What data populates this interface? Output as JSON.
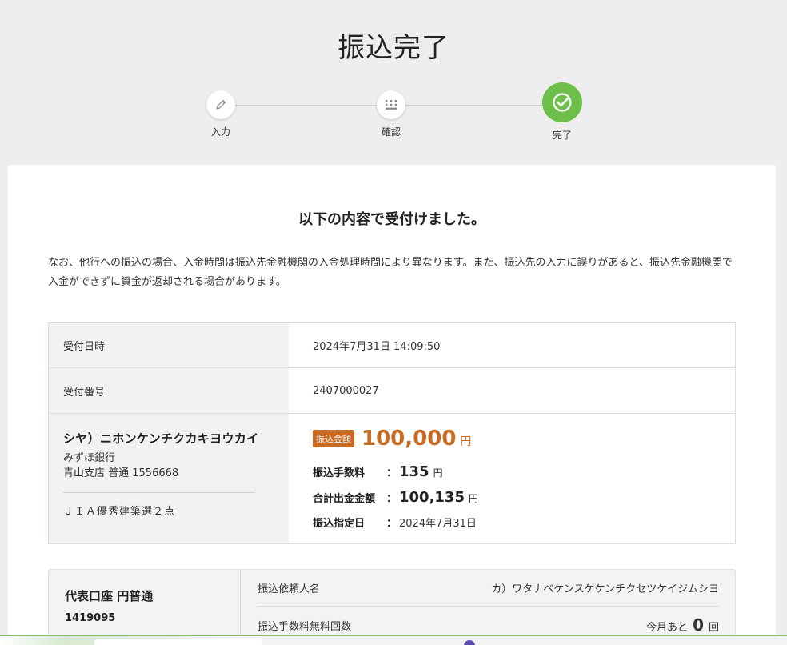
{
  "page": {
    "title": "振込完了"
  },
  "stepper": {
    "steps": [
      {
        "label": "入力",
        "icon": "pencil-icon",
        "status": "done"
      },
      {
        "label": "確認",
        "icon": "keypad-icon",
        "status": "done"
      },
      {
        "label": "完了",
        "icon": "check-circle-icon",
        "status": "current"
      }
    ],
    "accent": "#6cc04a"
  },
  "card": {
    "heading": "以下の内容で受付けました。",
    "notice": "なお、他行への振込の場合、入金時間は振込先金融機関の入金処理時間により異なります。また、振込先の入力に誤りがあると、振込先金融機関で入金ができずに資金が返却される場合があります。"
  },
  "details": {
    "received_at_label": "受付日時",
    "received_at_value": "2024年7月31日 14:09:50",
    "receipt_no_label": "受付番号",
    "receipt_no_value": "2407000027",
    "payee": {
      "name": "シヤ）ニホンケンチクカキヨウカイ",
      "bank": "みずほ銀行",
      "branch_account": "青山支店 普通 1556668",
      "memo": "ＪＩＡ優秀建築選２点"
    },
    "amount": {
      "badge": "振込金額",
      "value": "100,000",
      "unit": "円",
      "color": "#c96a21"
    },
    "fee": {
      "label": "振込手数料",
      "colon": "：",
      "value": "135",
      "unit": "円"
    },
    "total": {
      "label": "合計出金金額",
      "colon": "：",
      "value": "100,135",
      "unit": "円"
    },
    "date": {
      "label": "振込指定日",
      "colon": "：",
      "value": "2024年7月31日"
    }
  },
  "account": {
    "type": "代表口座 円普通",
    "number": "1419095",
    "requester_label": "振込依頼人名",
    "requester_value": "カ）ワタナベケンスケケンチクセツケイジムシヨ",
    "free_count_label": "振込手数料無料回数",
    "free_count_prefix": "今月あと",
    "free_count_value": "0",
    "free_count_unit": "回"
  }
}
